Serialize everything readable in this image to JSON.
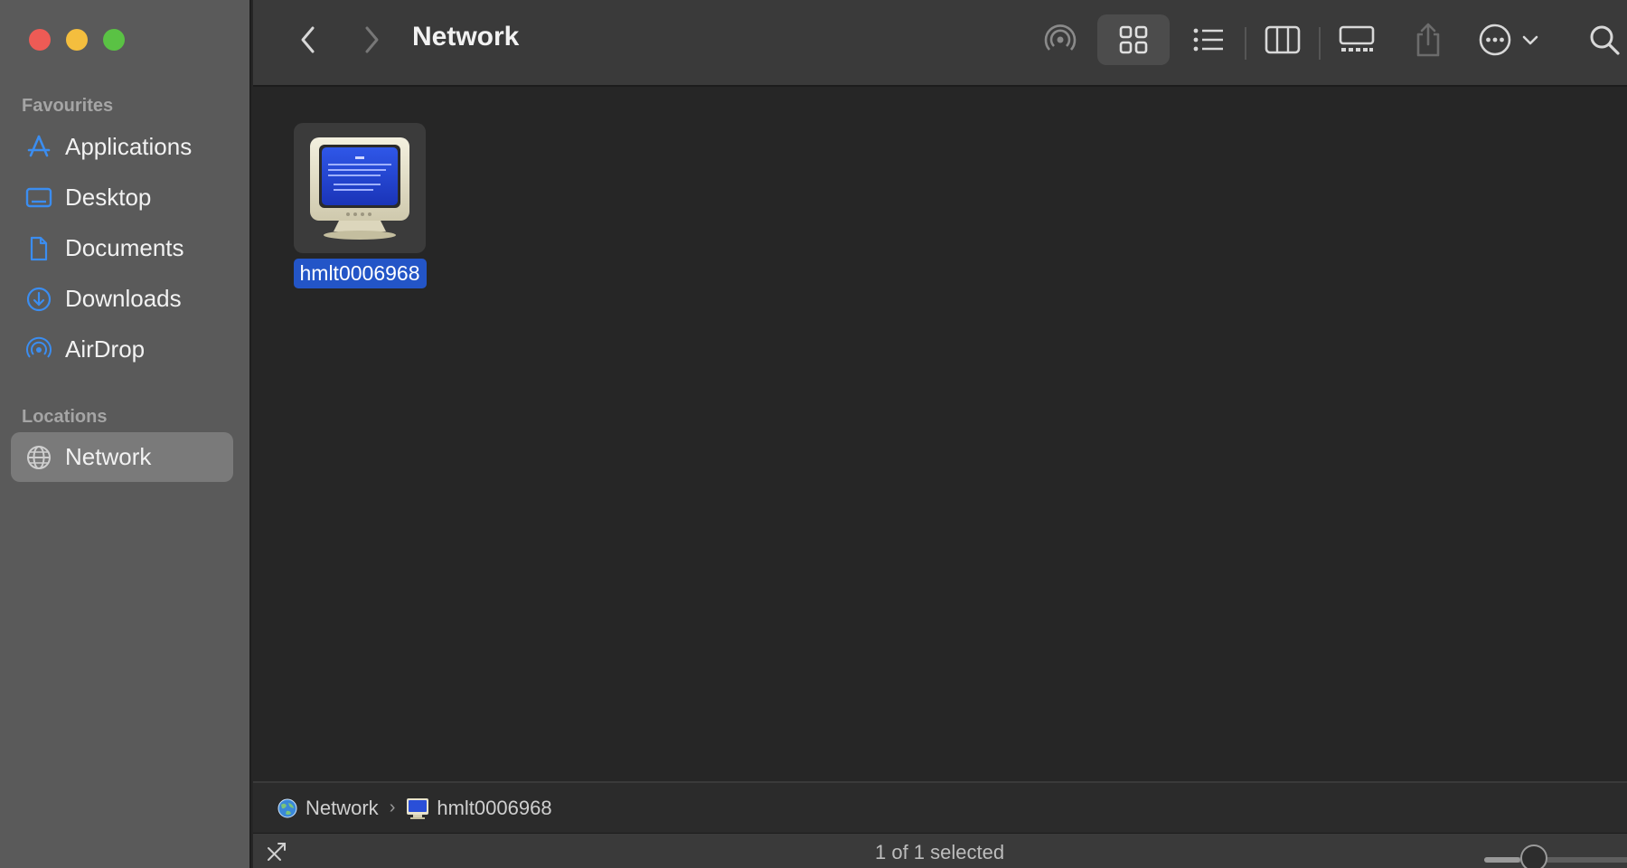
{
  "window": {
    "title": "Network"
  },
  "sidebar": {
    "favourites_title": "Favourites",
    "favourites": [
      {
        "label": "Applications",
        "icon": "applications-icon"
      },
      {
        "label": "Desktop",
        "icon": "desktop-icon"
      },
      {
        "label": "Documents",
        "icon": "document-icon"
      },
      {
        "label": "Downloads",
        "icon": "download-icon"
      },
      {
        "label": "AirDrop",
        "icon": "airdrop-icon"
      }
    ],
    "locations_title": "Locations",
    "locations": [
      {
        "label": "Network",
        "icon": "network-globe-icon",
        "selected": true
      }
    ]
  },
  "content": {
    "items": [
      {
        "name": "hmlt0006968",
        "icon": "computer-monitor-icon",
        "selected": true
      }
    ]
  },
  "pathbar": {
    "segments": [
      {
        "label": "Network",
        "icon": "network-globe-icon"
      },
      {
        "label": "hmlt0006968",
        "icon": "computer-monitor-icon"
      }
    ]
  },
  "status": {
    "text": "1 of 1 selected"
  },
  "colors": {
    "accent": "#2355c7",
    "sidebar_bg": "#5a5a5a",
    "content_bg": "#262626",
    "toolbar_bg": "#3a3a3a"
  }
}
